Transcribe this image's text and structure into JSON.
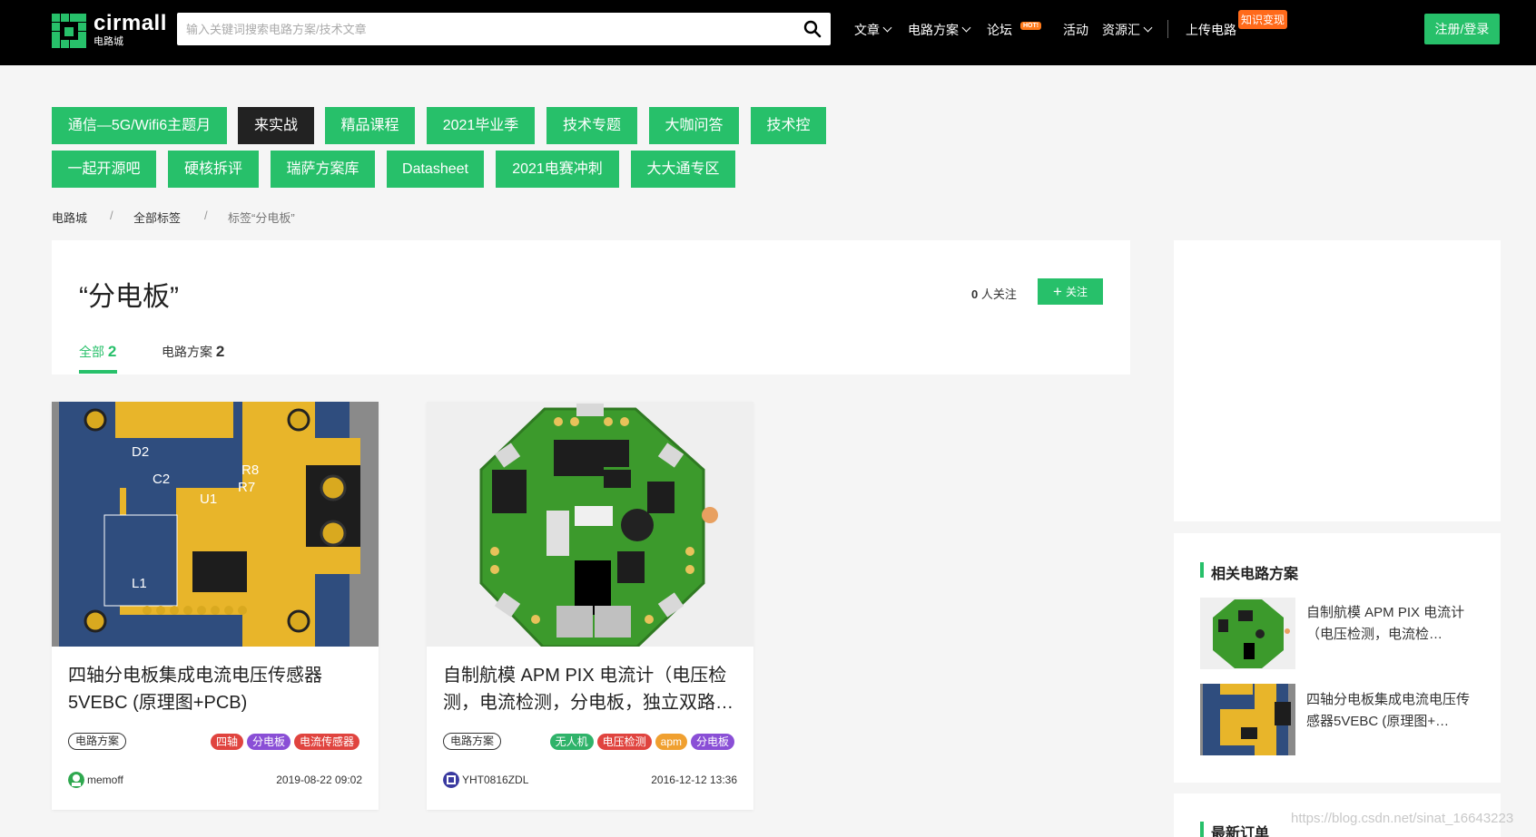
{
  "header": {
    "logo_en": "cirmall",
    "logo_cn": "电路城",
    "search_placeholder": "输入关键词搜索电路方案/技术文章",
    "nav": {
      "article": "文章",
      "plans": "电路方案",
      "forum": "论坛",
      "forum_badge": "HOT!",
      "activity": "活动",
      "resources": "资源汇",
      "upload": "上传电路",
      "upload_badge": "知识变现"
    },
    "login": "注册/登录"
  },
  "tags": {
    "row1": [
      "通信—5G/Wifi6主题月",
      "来实战",
      "精品课程",
      "2021毕业季",
      "技术专题",
      "大咖问答",
      "技术控"
    ],
    "row2": [
      "一起开源吧",
      "硬核拆评",
      "瑞萨方案库",
      "Datasheet",
      "2021电赛冲刺",
      "大大通专区"
    ]
  },
  "breadcrumb": {
    "home": "电路城",
    "all_tags": "全部标签",
    "current": "标签“分电板”",
    "sep": "/"
  },
  "topic": {
    "title": "“分电板”",
    "follow_count": "0",
    "follow_label": "人关注",
    "follow_button": "关注",
    "tabs": [
      {
        "label": "全部",
        "count": "2"
      },
      {
        "label": "电路方案",
        "count": "2"
      }
    ]
  },
  "cards": [
    {
      "title": "四轴分电板集成电流电压传感器5VEBC (原理图+PCB)",
      "category": "电路方案",
      "tags": [
        {
          "label": "四轴",
          "color": "#e0443f"
        },
        {
          "label": "分电板",
          "color": "#8a4fd6"
        },
        {
          "label": "电流传感器",
          "color": "#e0443f"
        }
      ],
      "author": "memoff",
      "date": "2019-08-22 09:02"
    },
    {
      "title": "自制航模 APM PIX 电流计（电压检测，电流检测，分电板，独立双路…",
      "category": "电路方案",
      "tags": [
        {
          "label": "无人机",
          "color": "#2fb36a"
        },
        {
          "label": "电压检测",
          "color": "#e0443f"
        },
        {
          "label": "apm",
          "color": "#f0a030"
        },
        {
          "label": "分电板",
          "color": "#8a4fd6"
        }
      ],
      "author": "YHT0816ZDL",
      "date": "2016-12-12 13:36"
    }
  ],
  "sidebar": {
    "related_title": "相关电路方案",
    "related": [
      {
        "title": "自制航模 APM PIX 电流计（电压检测，电流检…"
      },
      {
        "title": "四轴分电板集成电流电压传感器5VEBC (原理图+…"
      }
    ],
    "orders_title": "最新订单"
  },
  "watermark": "https://blog.csdn.net/sinat_16643223",
  "colors": {
    "accent": "#27c06a",
    "header_bg": "#000000",
    "page_bg": "#f5f5f5"
  }
}
